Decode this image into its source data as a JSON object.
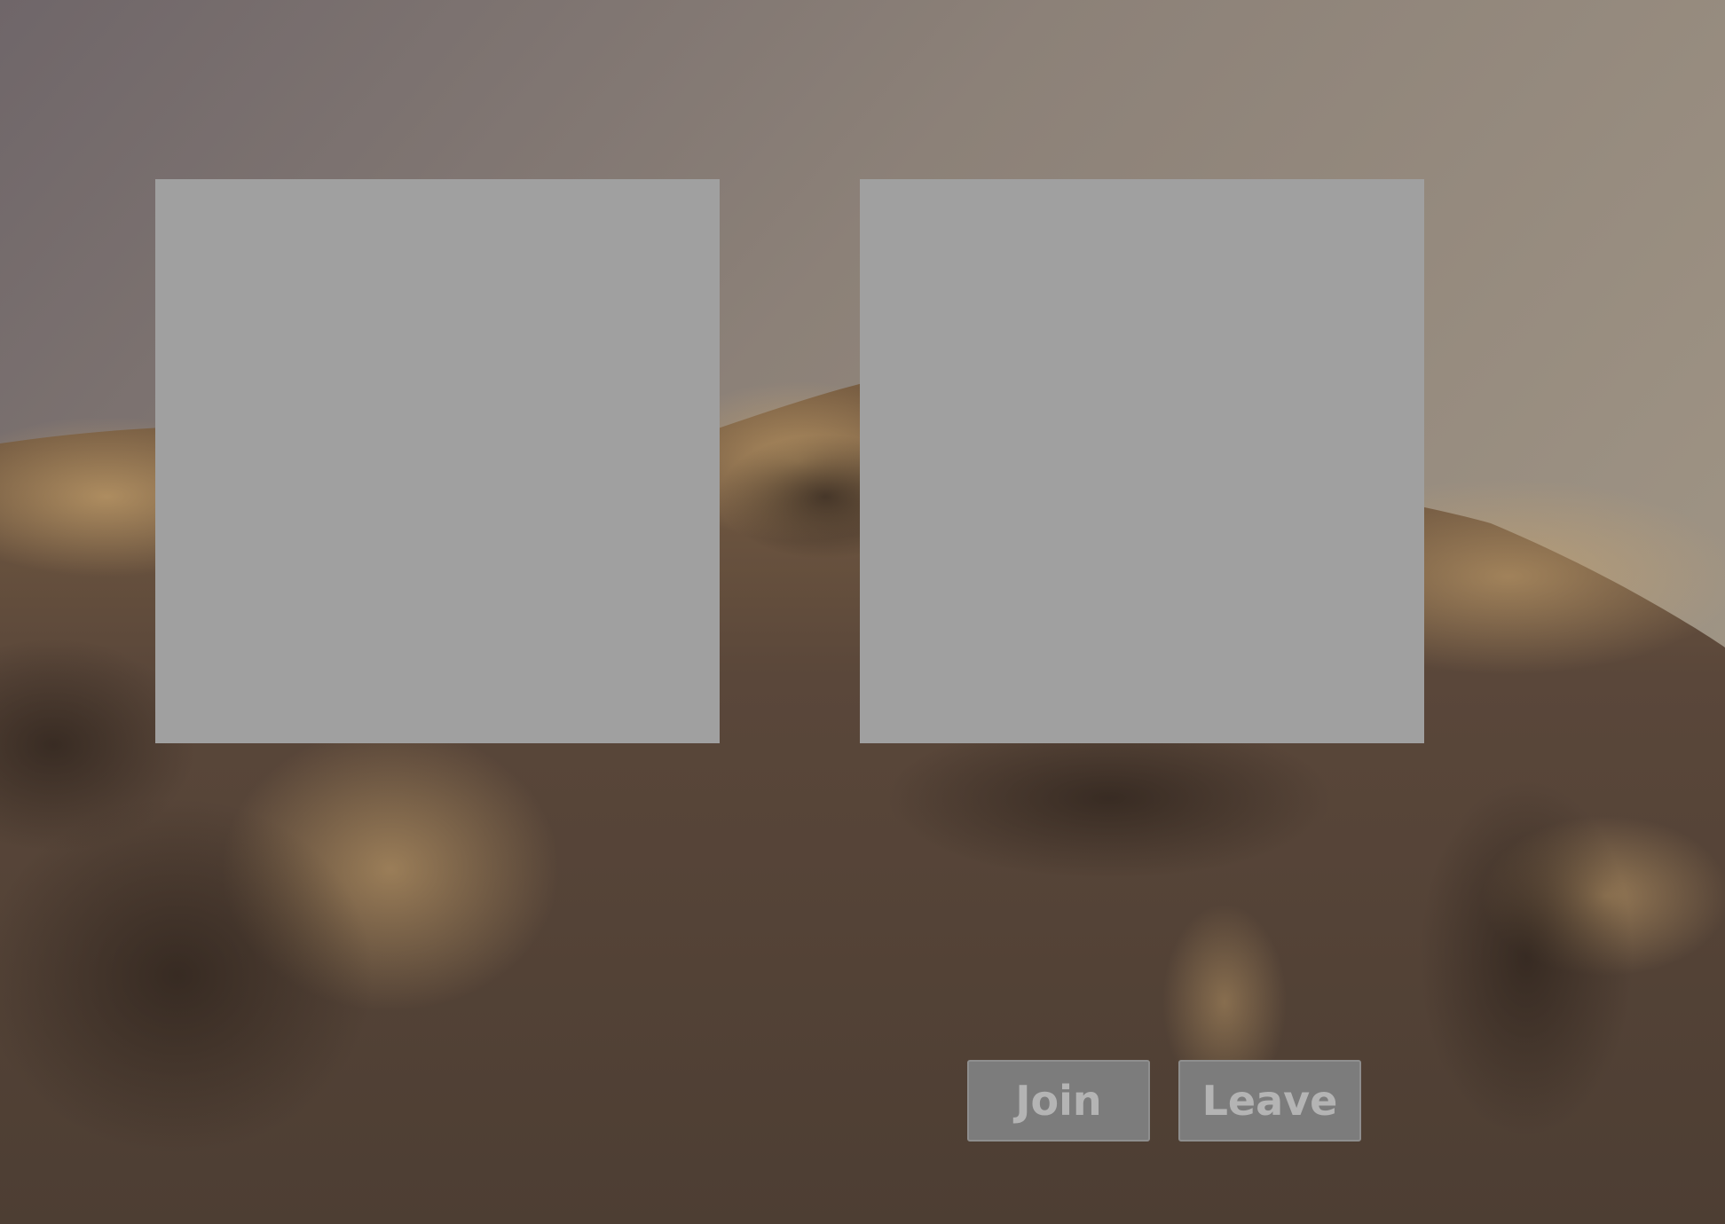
{
  "scene": {
    "description_icon": "desert-terrain-background"
  },
  "panels": [
    {
      "id": "left",
      "color": "#a0a0a0"
    },
    {
      "id": "right",
      "color": "#a0a0a0"
    }
  ],
  "buttons": {
    "join_label": "Join",
    "leave_label": "Leave"
  },
  "colors": {
    "sky_top": "#9a8f83",
    "terrain_dark": "#4a3a2e",
    "terrain_light": "#c9a46e",
    "button_bg": "#7c7c7c",
    "button_text": "#b4b4b4"
  }
}
